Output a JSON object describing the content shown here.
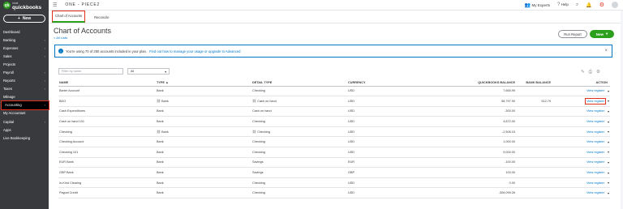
{
  "logo": {
    "mark": "qb",
    "small": "intuit",
    "name": "quickbooks"
  },
  "sidebar": {
    "new_label": "New",
    "items": [
      {
        "label": "Dashboard",
        "chev": false
      },
      {
        "label": "Banking",
        "chev": true
      },
      {
        "label": "Expenses",
        "chev": true
      },
      {
        "label": "Sales",
        "chev": true
      },
      {
        "label": "Projects",
        "chev": false
      },
      {
        "label": "Payroll",
        "chev": true
      },
      {
        "label": "Reports",
        "chev": true
      },
      {
        "label": "Taxes",
        "chev": true
      },
      {
        "label": "Mileage",
        "chev": false
      },
      {
        "label": "Accounting",
        "chev": true
      },
      {
        "label": "My Accountant",
        "chev": false
      },
      {
        "label": "Capital",
        "chev": true
      },
      {
        "label": "Apps",
        "chev": false
      },
      {
        "label": "Live Bookkeeping",
        "chev": false
      }
    ]
  },
  "topbar": {
    "company": "ONE - PIECE2",
    "experts": "My Experts",
    "help": "Help"
  },
  "tabs": [
    "Chart of Accounts",
    "Reconcile"
  ],
  "page": {
    "title": "Chart of Accounts",
    "all_lists": "< All Lists",
    "run_report": "Run Report",
    "new": "New"
  },
  "alert": {
    "text": "You're using 70 of 250 accounts included in your plan.",
    "link": "Find out how to manage your usage or upgrade to Advanced"
  },
  "filter": {
    "placeholder": "Filter by name",
    "select_value": "All"
  },
  "table": {
    "headers": [
      "NAME",
      "TYPE",
      "DETAIL TYPE",
      "CURRENCY",
      "QUICKBOOKS BALANCE",
      "BANK BALANCE",
      "ACTION"
    ],
    "rows": [
      {
        "name": "Barter Account",
        "type": "Bank",
        "type_icon": false,
        "detail": "Checking",
        "detail_icon": false,
        "currency": "USD",
        "qb": "7,665.99",
        "bank": ""
      },
      {
        "name": "BDO",
        "type": "Bank",
        "type_icon": true,
        "detail": "Cash on hand",
        "detail_icon": true,
        "currency": "USD",
        "qb": "58,797.90",
        "bank": "512.79"
      },
      {
        "name": "Cash Expenditures",
        "type": "Bank",
        "type_icon": false,
        "detail": "Cash on hand",
        "detail_icon": false,
        "currency": "USD",
        "qb": "-300.00",
        "bank": ""
      },
      {
        "name": "Cash on hand 101",
        "type": "Bank",
        "type_icon": false,
        "detail": "Checking",
        "detail_icon": false,
        "currency": "USD",
        "qb": "4,872.00",
        "bank": ""
      },
      {
        "name": "Checking",
        "type": "Bank",
        "type_icon": true,
        "detail": "Checking",
        "detail_icon": true,
        "currency": "USD",
        "qb": "-2,506.15",
        "bank": ""
      },
      {
        "name": "Checking Account",
        "type": "Bank",
        "type_icon": false,
        "detail": "Checking",
        "detail_icon": false,
        "currency": "USD",
        "qb": "1,000.00",
        "bank": ""
      },
      {
        "name": "Checking 101",
        "type": "Bank",
        "type_icon": false,
        "detail": "Checking",
        "detail_icon": false,
        "currency": "USD",
        "qb": "9,000.00",
        "bank": ""
      },
      {
        "name": "EUR Bank",
        "type": "Bank",
        "type_icon": false,
        "detail": "Savings",
        "detail_icon": false,
        "currency": "EUR",
        "qb": "-100.00",
        "bank": ""
      },
      {
        "name": "GBP Bank",
        "type": "Bank",
        "type_icon": false,
        "detail": "Savings",
        "detail_icon": false,
        "currency": "GBP",
        "qb": "100.00",
        "bank": ""
      },
      {
        "name": "In-Kind Clearing",
        "type": "Bank",
        "type_icon": false,
        "detail": "Checking",
        "detail_icon": false,
        "currency": "USD",
        "qb": "0.00",
        "bank": ""
      },
      {
        "name": "Paypal Credit",
        "type": "Bank",
        "type_icon": false,
        "detail": "Checking",
        "detail_icon": false,
        "currency": "USD",
        "qb": "-306,099.26",
        "bank": ""
      }
    ],
    "action_label": "View register"
  }
}
